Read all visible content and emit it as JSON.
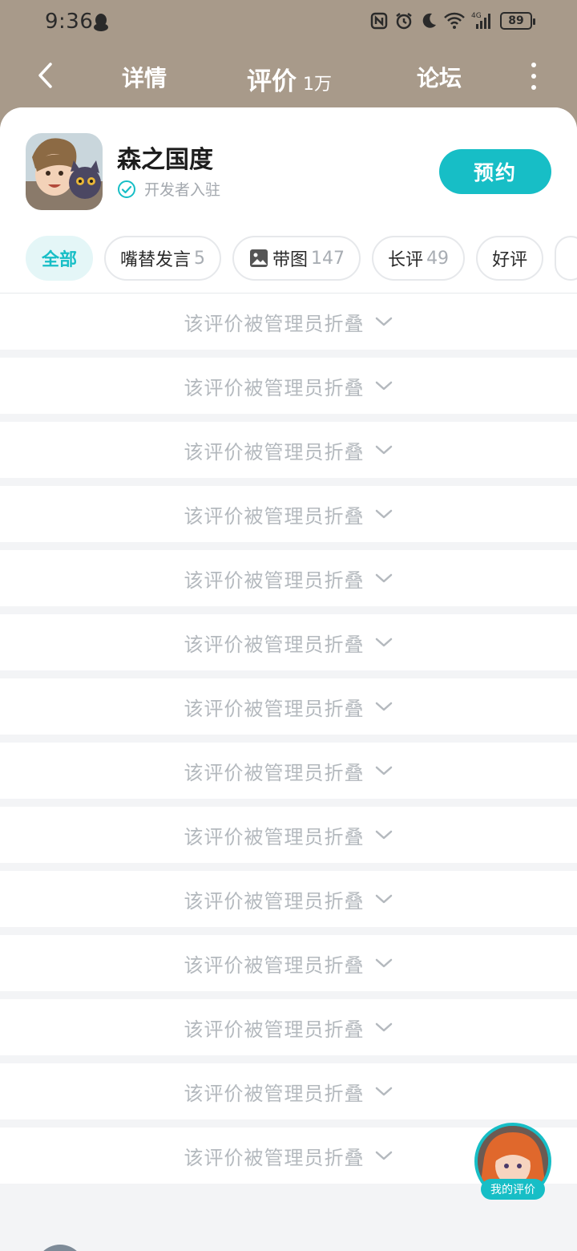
{
  "status": {
    "time": "9:36",
    "battery": "89",
    "network": "4G"
  },
  "nav": {
    "detail": "详情",
    "review": "评价",
    "review_count": "1万",
    "forum": "论坛"
  },
  "app": {
    "name": "森之国度",
    "developer_badge": "开发者入驻",
    "reserve_label": "预约"
  },
  "filters": [
    {
      "label": "全部",
      "count": ""
    },
    {
      "label": "嘴替发言",
      "count": "5"
    },
    {
      "label": "带图",
      "count": "147"
    },
    {
      "label": "长评",
      "count": "49"
    },
    {
      "label": "好评",
      "count": ""
    }
  ],
  "folded_label": "该评价被管理员折叠",
  "folded_items": [
    {
      "label": "该评价被管理员折叠"
    },
    {
      "label": "该评价被管理员折叠"
    },
    {
      "label": "该评价被管理员折叠"
    },
    {
      "label": "该评价被管理员折叠"
    },
    {
      "label": "该评价被管理员折叠"
    },
    {
      "label": "该评价被管理员折叠"
    },
    {
      "label": "该评价被管理员折叠"
    },
    {
      "label": "该评价被管理员折叠"
    },
    {
      "label": "该评价被管理员折叠"
    },
    {
      "label": "该评价被管理员折叠"
    },
    {
      "label": "该评价被管理员折叠"
    },
    {
      "label": "该评价被管理员折叠"
    },
    {
      "label": "该评价被管理员折叠"
    },
    {
      "label": "该评价被管理员折叠"
    }
  ],
  "my_review": "我的评价",
  "colors": {
    "accent": "#17bec6",
    "header_bg": "#a89a8a"
  }
}
